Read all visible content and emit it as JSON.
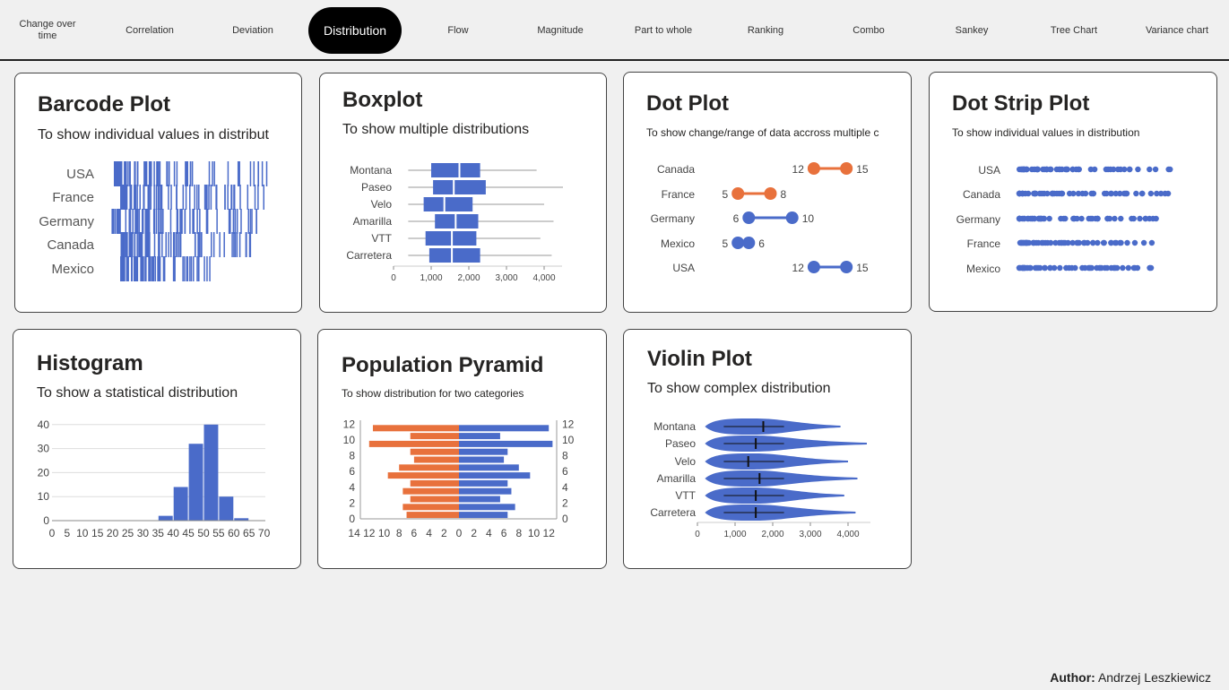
{
  "nav": {
    "items": [
      {
        "label": "Change over time",
        "active": false
      },
      {
        "label": "Correlation",
        "active": false
      },
      {
        "label": "Deviation",
        "active": false
      },
      {
        "label": "Distribution",
        "active": true
      },
      {
        "label": "Flow",
        "active": false
      },
      {
        "label": "Magnitude",
        "active": false
      },
      {
        "label": "Part to whole",
        "active": false
      },
      {
        "label": "Ranking",
        "active": false
      },
      {
        "label": "Combo",
        "active": false
      },
      {
        "label": "Sankey",
        "active": false
      },
      {
        "label": "Tree Chart",
        "active": false
      },
      {
        "label": "Variance chart",
        "active": false
      }
    ]
  },
  "cards": {
    "barcode": {
      "title": "Barcode Plot",
      "subtitle": "To show individual values in distribut"
    },
    "boxplot": {
      "title": "Boxplot",
      "subtitle": "To show multiple distributions"
    },
    "dot": {
      "title": "Dot Plot",
      "subtitle": "To show change/range of data accross multiple c"
    },
    "dotstrip": {
      "title": "Dot Strip Plot",
      "subtitle": "To show individual values in distribution"
    },
    "histogram": {
      "title": "Histogram",
      "subtitle": "To show a statistical distribution"
    },
    "pyramid": {
      "title": "Population Pyramid",
      "subtitle": "To show distribution for two categories"
    },
    "violin": {
      "title": "Violin Plot",
      "subtitle": "To show complex distribution"
    }
  },
  "author": {
    "label": "Author:",
    "name": "Andrzej Leszkiewicz"
  },
  "colors": {
    "blue": "#4a6bc9",
    "orange": "#e8713c",
    "accent": "#000000"
  },
  "chart_data": [
    {
      "id": "barcode",
      "type": "scatter",
      "categories": [
        "USA",
        "France",
        "Germany",
        "Canada",
        "Mexico"
      ],
      "note_x_range": [
        0,
        100
      ]
    },
    {
      "id": "boxplot",
      "type": "bar",
      "categories": [
        "Montana",
        "Paseo",
        "Velo",
        "Amarilla",
        "VTT",
        "Carretera"
      ],
      "series": [
        {
          "values": [
            {
              "min": 200,
              "q1": 1000,
              "median": 1750,
              "q3": 2300,
              "max": 3800
            },
            {
              "min": 200,
              "q1": 1050,
              "median": 1600,
              "q3": 2450,
              "max": 4500
            },
            {
              "min": 200,
              "q1": 800,
              "median": 1350,
              "q3": 2100,
              "max": 4000
            },
            {
              "min": 200,
              "q1": 1100,
              "median": 1650,
              "q3": 2250,
              "max": 4250
            },
            {
              "min": 200,
              "q1": 850,
              "median": 1550,
              "q3": 2200,
              "max": 3900
            },
            {
              "min": 200,
              "q1": 950,
              "median": 1550,
              "q3": 2300,
              "max": 4200
            }
          ]
        }
      ],
      "xticks": [
        "0",
        "1,000",
        "2,000",
        "3,000",
        "4,000"
      ],
      "xlim": [
        0,
        4500
      ]
    },
    {
      "id": "dot",
      "type": "scatter",
      "categories": [
        "Canada",
        "France",
        "Germany",
        "Mexico",
        "USA"
      ],
      "series": [
        {
          "values": [
            [
              12,
              15
            ],
            [
              5,
              8
            ],
            [
              6,
              10
            ],
            [
              5,
              6
            ],
            [
              12,
              15
            ]
          ]
        }
      ],
      "highlight": [
        "orange",
        "orange",
        "blue",
        "blue",
        "blue"
      ],
      "xlim": [
        3,
        17
      ]
    },
    {
      "id": "dotstrip",
      "type": "scatter",
      "categories": [
        "USA",
        "Canada",
        "Germany",
        "France",
        "Mexico"
      ]
    },
    {
      "id": "histogram",
      "type": "bar",
      "categories": [
        "35",
        "40",
        "45",
        "50",
        "55",
        "60",
        "65"
      ],
      "values": [
        2,
        14,
        32,
        40,
        10,
        1,
        0
      ],
      "xticks": [
        "0",
        "5",
        "10",
        "15",
        "20",
        "25",
        "30",
        "35",
        "40",
        "45",
        "50",
        "55",
        "60",
        "65",
        "70"
      ],
      "yticks": [
        "0",
        "10",
        "20",
        "30",
        "40"
      ],
      "ylim": [
        0,
        42
      ]
    },
    {
      "id": "pyramid",
      "type": "bar",
      "categories": [
        "0",
        "1",
        "2",
        "3",
        "4",
        "5",
        "6",
        "7",
        "8",
        "9",
        "10",
        "11",
        "12"
      ],
      "series": [
        {
          "values": [
            7,
            7.5,
            6.5,
            7.5,
            6.5,
            9.5,
            8,
            6,
            6.5,
            12,
            6.5,
            11.5
          ]
        },
        {
          "values": [
            6.5,
            7.5,
            5.5,
            7,
            6.5,
            9.5,
            8,
            6,
            6.5,
            12.5,
            5.5,
            12
          ]
        }
      ],
      "xticks": [
        "14",
        "12",
        "10",
        "8",
        "6",
        "4",
        "2",
        "0",
        "2",
        "4",
        "6",
        "8",
        "10",
        "12"
      ],
      "yticks": [
        "0",
        "2",
        "4",
        "6",
        "8",
        "10",
        "12"
      ]
    },
    {
      "id": "violin",
      "type": "area",
      "categories": [
        "Montana",
        "Paseo",
        "Velo",
        "Amarilla",
        "VTT",
        "Carretera"
      ],
      "medians": [
        1750,
        1550,
        1350,
        1650,
        1550,
        1550
      ],
      "xticks": [
        "0",
        "1,000",
        "2,000",
        "3,000",
        "4,000"
      ],
      "xlim": [
        0,
        4500
      ]
    }
  ]
}
